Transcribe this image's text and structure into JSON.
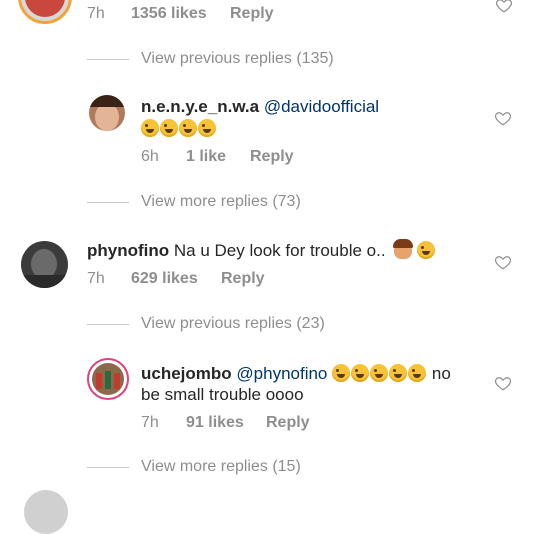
{
  "top_comment": {
    "time": "7h",
    "likes": "1356 likes",
    "reply": "Reply"
  },
  "thread1": {
    "view_previous": "View previous replies (135)",
    "reply": {
      "username": "n.e.n.y.e_n.w.a",
      "mention": "@davidoofficial",
      "time": "6h",
      "likes": "1 like",
      "reply": "Reply"
    },
    "view_more": "View more replies (73)"
  },
  "comment2": {
    "username": "phynofino",
    "text": "Na u Dey look for trouble o..",
    "time": "7h",
    "likes": "629 likes",
    "reply": "Reply"
  },
  "thread2": {
    "view_previous": "View previous replies (23)",
    "reply": {
      "username": "uchejombo",
      "mention": "@phynofino",
      "text_tail": "no",
      "text_line2": "be small trouble oooo",
      "time": "7h",
      "likes": "91 likes",
      "reply": "Reply"
    },
    "view_more": "View more replies (15)"
  },
  "icons": {
    "heart": "heart-outline-icon",
    "emoji_laugh": "rolling-on-floor-laughing-emoji",
    "emoji_woman": "woman-tipping-hand-emoji",
    "emoji_sweat": "grinning-squinting-emoji"
  },
  "colors": {
    "text": "#262626",
    "muted": "#8e8e8e",
    "mention": "#003569"
  }
}
